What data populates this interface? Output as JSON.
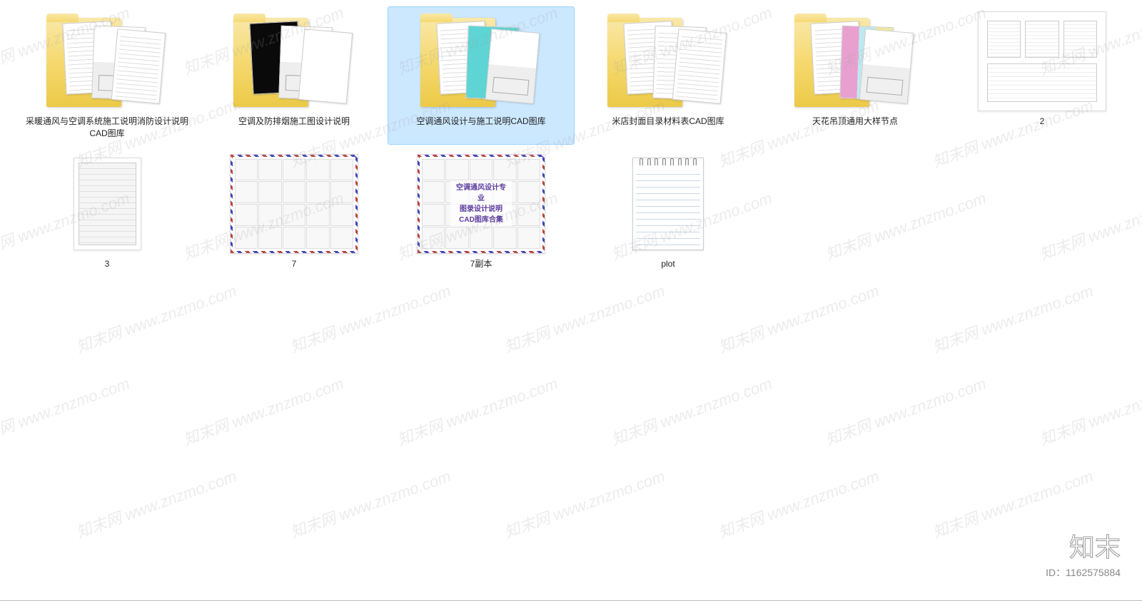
{
  "items": [
    {
      "label": "采暖通风与空调系统施工说明消防设计说明CAD图库",
      "type": "folder",
      "preview": "cad1"
    },
    {
      "label": "空调及防排烟施工图设计说明",
      "type": "folder",
      "preview": "black"
    },
    {
      "label": "空调通风设计与施工说明CAD图库",
      "type": "folder",
      "preview": "teal",
      "selected": true
    },
    {
      "label": "米店封面目录材料表CAD图库",
      "type": "folder",
      "preview": "lines"
    },
    {
      "label": "天花吊顶通用大样节点",
      "type": "folder",
      "preview": "colorful"
    },
    {
      "label": "2",
      "type": "image",
      "preview": "table2section"
    },
    {
      "label": "3",
      "type": "image",
      "preview": "table-portrait"
    },
    {
      "label": "7",
      "type": "image",
      "preview": "grid"
    },
    {
      "label": "7副本",
      "type": "image",
      "preview": "grid-title"
    },
    {
      "label": "plot",
      "type": "file",
      "preview": "notepad"
    }
  ],
  "overlay_title_line1": "空调通风设计专业",
  "overlay_title_line2": "图录设计说明CAD图库合集",
  "watermark_text": "知末网 www.znzmo.com",
  "logo": {
    "text": "知末",
    "id": "ID：1162575884"
  }
}
